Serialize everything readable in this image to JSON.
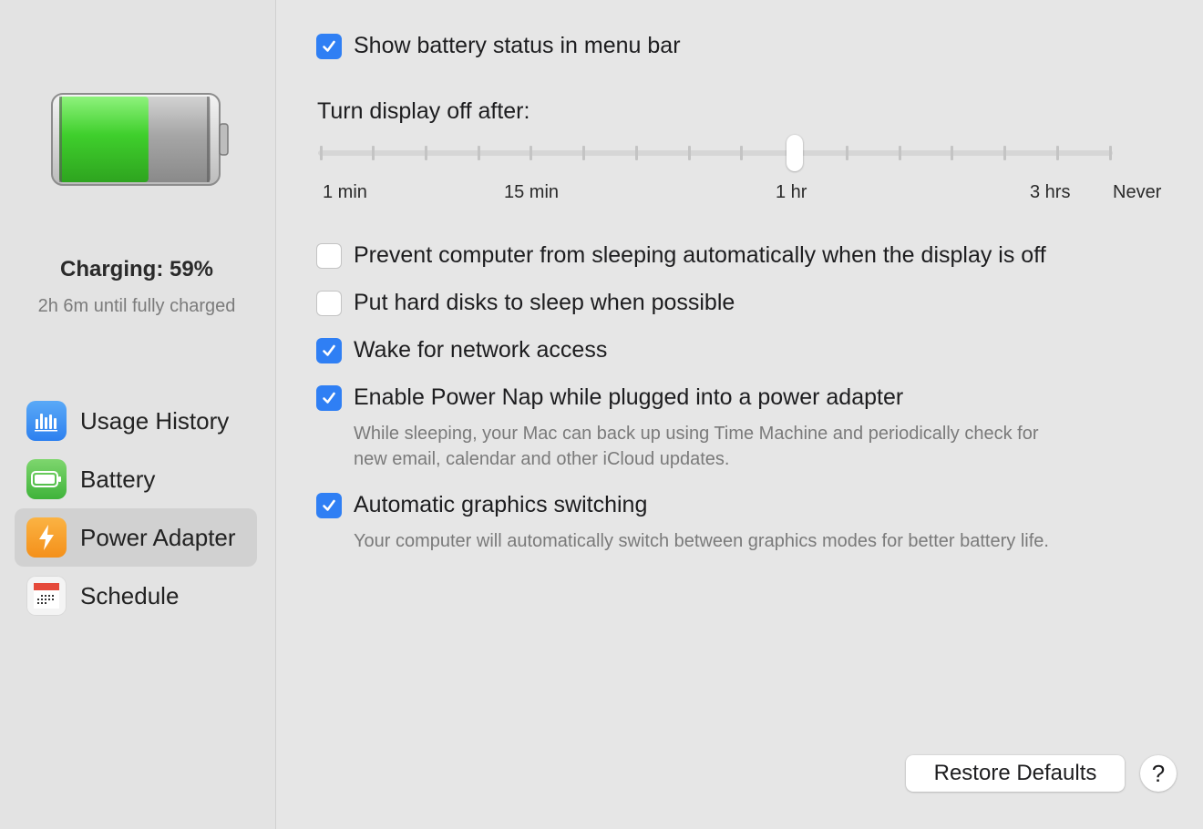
{
  "sidebar": {
    "battery_level_fraction": 0.59,
    "status_title": "Charging: 59%",
    "status_subtitle": "2h 6m until fully charged",
    "items": [
      {
        "label": "Usage History",
        "icon": "bar-chart-icon",
        "selected": false
      },
      {
        "label": "Battery",
        "icon": "battery-icon",
        "selected": false
      },
      {
        "label": "Power Adapter",
        "icon": "lightning-bolt-icon",
        "selected": true
      },
      {
        "label": "Schedule",
        "icon": "calendar-icon",
        "selected": false
      }
    ]
  },
  "main": {
    "show_battery_status": {
      "label": "Show battery status in menu bar",
      "checked": true
    },
    "display_off": {
      "label": "Turn display off after:",
      "tick_count": 16,
      "selected_label": "1 hr",
      "tick_labels": [
        "1 min",
        "15 min",
        "1 hr",
        "3 hrs",
        "Never"
      ]
    },
    "prevent_sleep": {
      "label": "Prevent computer from sleeping automatically when the display is off",
      "checked": false
    },
    "hard_disks_sleep": {
      "label": "Put hard disks to sleep when possible",
      "checked": false
    },
    "wake_network": {
      "label": "Wake for network access",
      "checked": true
    },
    "power_nap": {
      "label": "Enable Power Nap while plugged into a power adapter",
      "checked": true,
      "description_line1": "While sleeping, your Mac can back up using Time Machine and periodically check for",
      "description_line2": "new email, calendar and other iCloud updates."
    },
    "graphics_switching": {
      "label": "Automatic graphics switching",
      "checked": true,
      "description": "Your computer will automatically switch between graphics modes for better battery life."
    },
    "restore_defaults_label": "Restore Defaults",
    "help_label": "?"
  },
  "colors": {
    "accent": "#2f7ff4",
    "battery_fill": "#3fcf2c",
    "power_icon": "#f4901a"
  }
}
